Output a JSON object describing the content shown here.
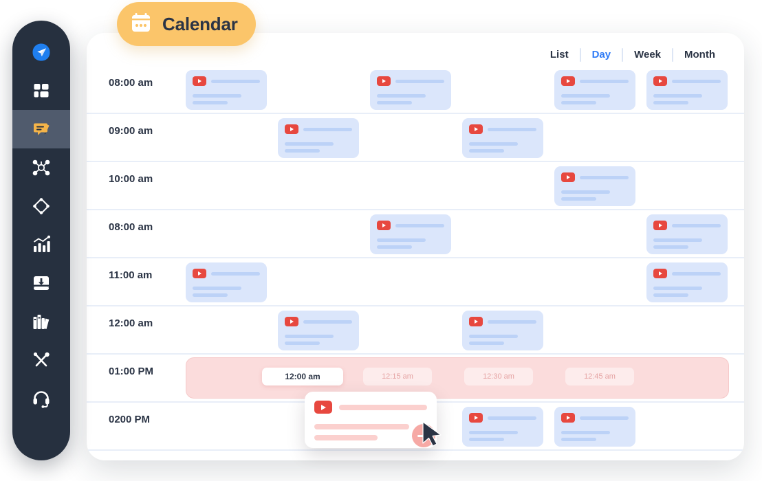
{
  "badge": {
    "label": "Calendar",
    "icon": "calendar-icon",
    "bg": "#fbc56a"
  },
  "sidebar": {
    "bg": "#26303f",
    "active_bg": "#505b6d",
    "items": [
      {
        "name": "send-icon",
        "label": "Send",
        "active": false
      },
      {
        "name": "dashboard-icon",
        "label": "Dashboard",
        "active": false
      },
      {
        "name": "chat-edit-icon",
        "label": "Messages",
        "active": true
      },
      {
        "name": "network-icon",
        "label": "Network",
        "active": false
      },
      {
        "name": "diamond-icon",
        "label": "Rewards",
        "active": false
      },
      {
        "name": "analytics-icon",
        "label": "Analytics",
        "active": false
      },
      {
        "name": "inbox-download-icon",
        "label": "Inbox",
        "active": false
      },
      {
        "name": "library-icon",
        "label": "Library",
        "active": false
      },
      {
        "name": "tools-icon",
        "label": "Tools",
        "active": false
      },
      {
        "name": "headset-icon",
        "label": "Support",
        "active": false
      }
    ]
  },
  "tabs": {
    "items": [
      {
        "label": "List",
        "active": false
      },
      {
        "label": "Day",
        "active": true
      },
      {
        "label": "Week",
        "active": false
      },
      {
        "label": "Month",
        "active": false
      }
    ],
    "active_color": "#2f7bf6"
  },
  "schedule": {
    "card_color": "#dbe6fb",
    "highlight_color": "#fbdcdc",
    "rows": [
      {
        "time": "08:00 am",
        "events": [
          0,
          2,
          4,
          5
        ],
        "highlighted": false
      },
      {
        "time": "09:00 am",
        "events": [
          1,
          3
        ],
        "highlighted": false
      },
      {
        "time": "10:00 am",
        "events": [
          4
        ],
        "highlighted": false
      },
      {
        "time": "08:00 am",
        "events": [
          2,
          5
        ],
        "highlighted": false
      },
      {
        "time": "11:00 am",
        "events": [
          0,
          5
        ],
        "highlighted": false
      },
      {
        "time": "12:00 am",
        "events": [
          1,
          3
        ],
        "highlighted": false
      },
      {
        "time": "01:00 PM",
        "events": [],
        "highlighted": true
      },
      {
        "time": "0200 PM",
        "events": [
          3,
          4
        ],
        "highlighted": false
      }
    ],
    "slots": [
      {
        "label": "12:00 am",
        "selected": true
      },
      {
        "label": "12:15 am",
        "selected": false
      },
      {
        "label": "12:30 am",
        "selected": false
      },
      {
        "label": "12:45 am",
        "selected": false
      }
    ]
  },
  "drag_card": {
    "icon": "youtube-play-icon",
    "add_button": "add-event-button",
    "accent": "#f6a9a5"
  }
}
